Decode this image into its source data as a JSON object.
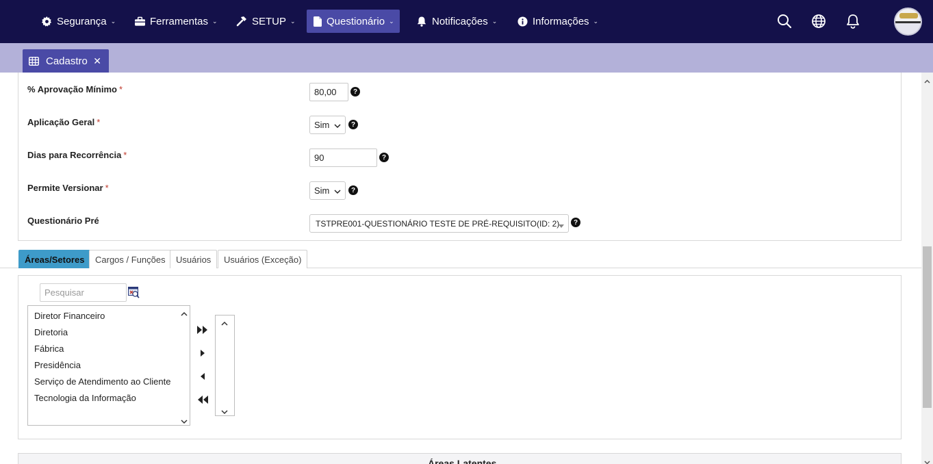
{
  "nav": {
    "menu": [
      {
        "label": "Segurança",
        "icon": "gear-icon"
      },
      {
        "label": "Ferramentas",
        "icon": "toolbox-icon"
      },
      {
        "label": "SETUP",
        "icon": "hammer-icon"
      },
      {
        "label": "Questionário",
        "icon": "file-icon",
        "active": true
      },
      {
        "label": "Notificações",
        "icon": "bell-icon"
      },
      {
        "label": "Informações",
        "icon": "info-icon"
      }
    ],
    "right_icons": [
      "search-icon",
      "globe-icon",
      "bell-outline-icon",
      "avatar"
    ]
  },
  "tabs": {
    "open": [
      {
        "label": "Cadastro",
        "icon": "table-icon"
      }
    ]
  },
  "form": {
    "fields": [
      {
        "label": "% Aprovação Mínimo",
        "required": "*",
        "value": "80,00",
        "type": "input"
      },
      {
        "label": "Aplicação Geral",
        "required": "*",
        "value": "Sim",
        "type": "select"
      },
      {
        "label": "Dias para Recorrência",
        "required": "*",
        "value": "90",
        "type": "input"
      },
      {
        "label": "Permite Versionar",
        "required": "*",
        "value": "Sim",
        "type": "select"
      },
      {
        "label": "Questionário Pré",
        "value": "TSTPRE001-QUESTIONÁRIO TESTE DE PRÉ-REQUISITO(ID: 2)",
        "type": "select"
      }
    ],
    "help_glyph": "?"
  },
  "subtabs": [
    {
      "label": "Áreas/Setores",
      "active": true
    },
    {
      "label": "Cargos / Funções"
    },
    {
      "label": "Usuários"
    },
    {
      "label": "Usuários (Exceção)"
    }
  ],
  "picker": {
    "search_placeholder": "Pesquisar",
    "available": [
      "Diretor Financeiro",
      "Diretoria",
      "Fábrica",
      "Presidência",
      "Serviço de Atendimento ao Cliente",
      "Tecnologia da Informação"
    ],
    "selected": []
  },
  "bottom_panel": {
    "title": "Áreas Latentes"
  },
  "colors": {
    "navbar": "#14114a",
    "active_menu": "#4a4aa6",
    "tabstrip": "#b3b1d9",
    "active_subtab": "#3e9bc9",
    "required": "#c0392b"
  }
}
